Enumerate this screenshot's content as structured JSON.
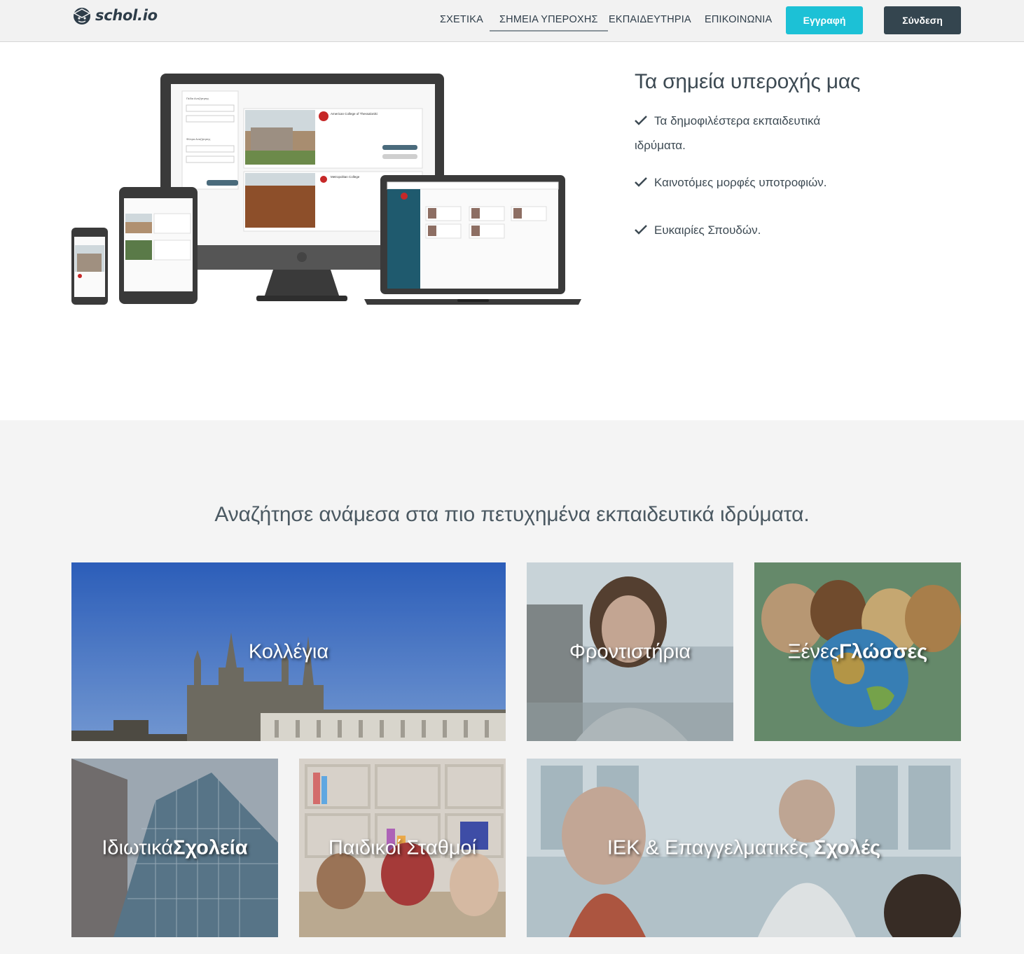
{
  "brand": {
    "name": "schol.io"
  },
  "nav": {
    "items": [
      {
        "label": "ΣΧΕΤΙΚΑ"
      },
      {
        "label": "ΣΗΜΕΙΑ ΥΠΕΡΟΧΗΣ"
      },
      {
        "label": "ΕΚΠΑΙΔΕΥΤΗΡΙΑ"
      },
      {
        "label": "ΕΠΙΚΟΙΝΩΝΙΑ"
      }
    ],
    "active_index": 1,
    "register_label": "Εγγραφή",
    "login_label": "Σύνδεση"
  },
  "hero": {
    "title": "Τα σημεία υπεροχής μας",
    "features": [
      "Τα δημοφιλέστερα εκπαιδευτικά ιδρύματα.",
      "Καινοτόμες μορφές υποτροφιών.",
      "Ευκαιρίες Σπουδών."
    ],
    "mockup": {
      "desktop_list": [
        "American College of Thessaloniki",
        "Metropolitan College"
      ],
      "desktop_sidebar": [
        "Πεδία Αναζήτησης",
        "Φίλτρα Αναζήτησης"
      ]
    }
  },
  "categories": {
    "title": "Αναζήτησε ανάμεσα στα πιο πετυχημένα εκπαιδευτικά ιδρύματα.",
    "tiles": [
      {
        "light": "Κολλέγια",
        "bold": ""
      },
      {
        "light": "Φροντιστήρια",
        "bold": ""
      },
      {
        "light": "Ξένες",
        "bold": "Γλώσσες"
      },
      {
        "light": "Ιδιωτικά",
        "bold": "Σχολεία"
      },
      {
        "light": "Παιδικοί Σταθμοί",
        "bold": ""
      },
      {
        "light": "ΙΕΚ & Επαγγελματικές ",
        "bold": "Σχολές"
      }
    ]
  },
  "colors": {
    "accent": "#1cc1d6",
    "dark": "#34454f",
    "text": "#3d4a53"
  }
}
